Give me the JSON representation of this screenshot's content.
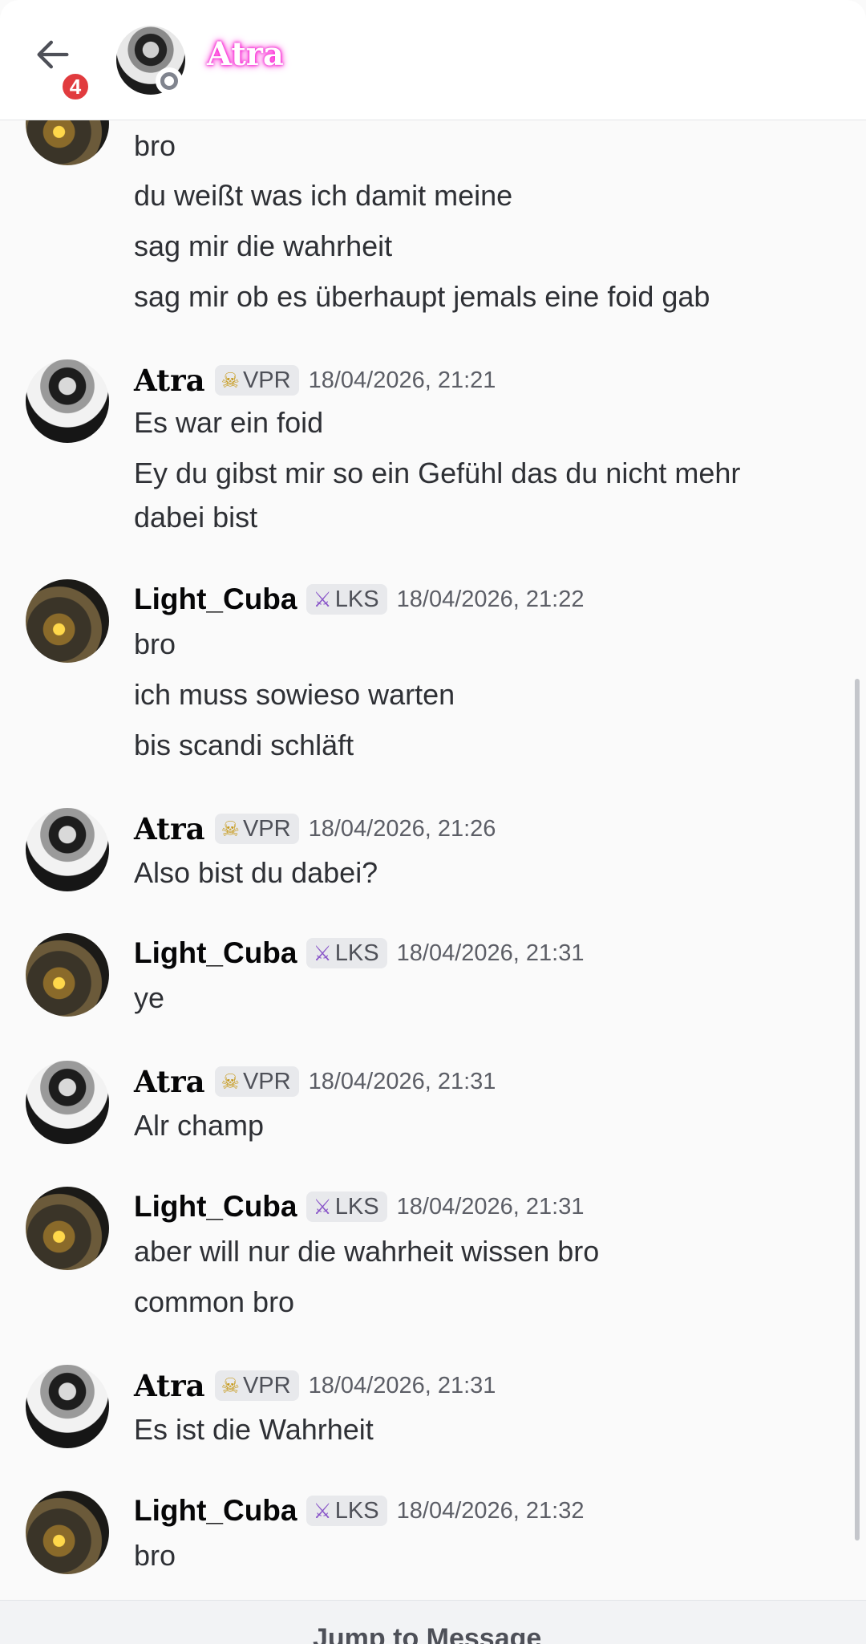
{
  "header": {
    "title": "Atra",
    "unread_count": "4"
  },
  "messages": [
    {
      "author": null,
      "lines": [
        "bro",
        "du weißt was ich damit meine",
        "sag mir die wahrheit",
        "sag mir ob es überhaupt jemals eine foid gab"
      ]
    },
    {
      "author": "Atra",
      "tag": "VPR",
      "tag_icon": "skull-icon",
      "time": "18/04/2026, 21:21",
      "lines": [
        "Es war ein foid",
        "Ey du gibst mir so ein Gefühl das du nicht mehr",
        "dabei bist"
      ]
    },
    {
      "author": "Light_Cuba",
      "tag": "LKS",
      "tag_icon": "sword-icon",
      "time": "18/04/2026, 21:22",
      "lines": [
        "bro",
        "ich muss sowieso warten",
        "bis scandi schläft"
      ]
    },
    {
      "author": "Atra",
      "tag": "VPR",
      "tag_icon": "skull-icon",
      "time": "18/04/2026, 21:26",
      "lines": [
        "Also bist du dabei?"
      ]
    },
    {
      "author": "Light_Cuba",
      "tag": "LKS",
      "tag_icon": "sword-icon",
      "time": "18/04/2026, 21:31",
      "lines": [
        "ye"
      ]
    },
    {
      "author": "Atra",
      "tag": "VPR",
      "tag_icon": "skull-icon",
      "time": "18/04/2026, 21:31",
      "lines": [
        "Alr champ"
      ]
    },
    {
      "author": "Light_Cuba",
      "tag": "LKS",
      "tag_icon": "sword-icon",
      "time": "18/04/2026, 21:31",
      "lines": [
        "aber will nur die wahrheit wissen bro",
        "common bro"
      ]
    },
    {
      "author": "Atra",
      "tag": "VPR",
      "tag_icon": "skull-icon",
      "time": "18/04/2026, 21:31",
      "lines": [
        "Es ist die Wahrheit"
      ]
    },
    {
      "author": "Light_Cuba",
      "tag": "LKS",
      "tag_icon": "sword-icon",
      "time": "18/04/2026, 21:32",
      "lines": [
        "bro"
      ]
    }
  ],
  "jump_bar": {
    "label": "Jump to Message"
  },
  "colors": {
    "badge": "#e13b3e",
    "title_glow": "#ff2bd6",
    "tag_bg": "#e8e9ec"
  }
}
